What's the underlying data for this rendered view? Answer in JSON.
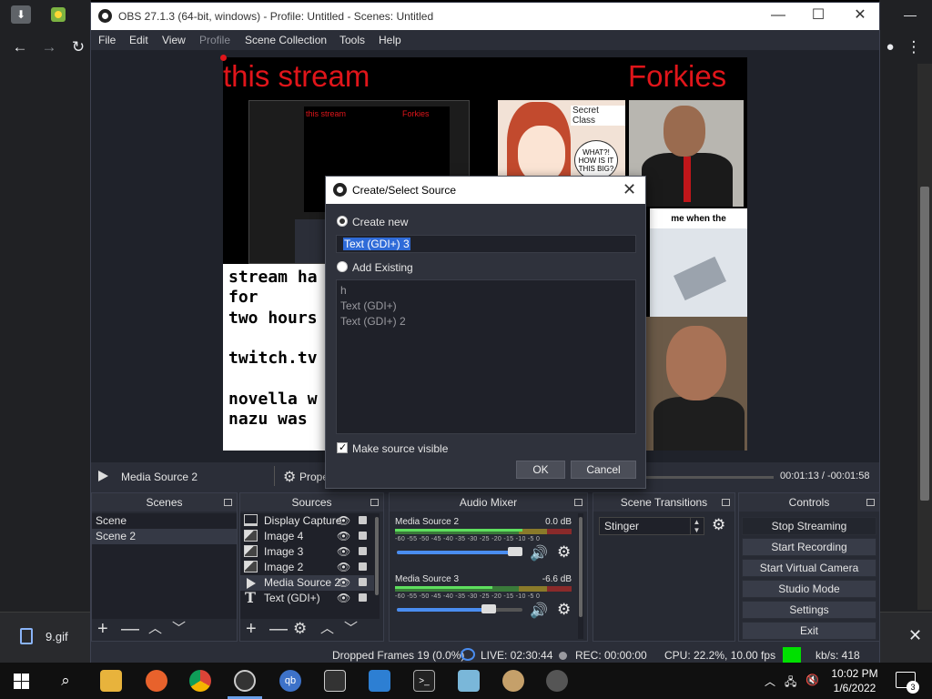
{
  "obs": {
    "title": "OBS 27.1.3 (64-bit, windows) - Profile: Untitled - Scenes: Untitled",
    "menu": [
      "File",
      "Edit",
      "View",
      "Profile",
      "Scene Collection",
      "Tools",
      "Help"
    ],
    "canvas": {
      "title_left": "this stream",
      "title_right": "Forkies",
      "white_text": "stream ha\nfor\ntwo hours\n\ntwitch.tv\n\nnovella w\nnazu was",
      "nested_t1": "this stream",
      "nested_t2": "Forkies",
      "anime_caption": "Secret Class",
      "anime_bubble": "WHAT?! HOW IS IT THIS BIG?",
      "meme_text": "me when the"
    },
    "media_bar": {
      "source_name": "Media Source 2",
      "properties_label": "Prope",
      "time": "00:01:13 / -00:01:58"
    },
    "docks": {
      "scenes": {
        "title": "Scenes",
        "items": [
          "Scene",
          "Scene 2"
        ],
        "selected_index": 1
      },
      "sources": {
        "title": "Sources",
        "items": [
          {
            "label": "Display Capture",
            "icon": "monitor-icon"
          },
          {
            "label": "Image 4",
            "icon": "image-icon"
          },
          {
            "label": "Image 3",
            "icon": "image-icon"
          },
          {
            "label": "Image 2",
            "icon": "image-icon"
          },
          {
            "label": "Media Source 2",
            "icon": "play-icon"
          },
          {
            "label": "Text (GDI+)",
            "icon": "text-icon"
          }
        ]
      },
      "mixer": {
        "title": "Audio Mixer",
        "scale": "-60 -55 -50 -45 -40 -35 -30 -25 -20 -15 -10 -5 0",
        "channels": [
          {
            "name": "Media Source 2",
            "db": "0.0 dB",
            "level": 0.72,
            "volume": 0.94
          },
          {
            "name": "Media Source 3",
            "db": "-6.6 dB",
            "level": 0.55,
            "volume": 0.73
          }
        ]
      },
      "transitions": {
        "title": "Scene Transitions",
        "selected": "Stinger"
      },
      "controls": {
        "title": "Controls",
        "buttons": [
          "Stop Streaming",
          "Start Recording",
          "Start Virtual Camera",
          "Studio Mode",
          "Settings",
          "Exit"
        ]
      }
    },
    "status": {
      "dropped": "Dropped Frames 19 (0.0%)",
      "live": "LIVE: 02:30:44",
      "rec": "REC: 00:00:00",
      "cpu": "CPU: 22.2%, 10.00 fps",
      "kbs": "kb/s: 418",
      "status_color": "#00e000"
    }
  },
  "dialog": {
    "title": "Create/Select Source",
    "create_new_label": "Create new",
    "name_value": "Text (GDI+) 3",
    "add_existing_label": "Add Existing",
    "existing": [
      "h",
      "Text (GDI+)",
      "Text (GDI+) 2"
    ],
    "visible_label": "Make source visible",
    "ok": "OK",
    "cancel": "Cancel"
  },
  "downloads": {
    "file": "9.gif"
  },
  "taskbar": {
    "time": "10:02 PM",
    "date": "1/6/2022",
    "notifications": "3"
  }
}
